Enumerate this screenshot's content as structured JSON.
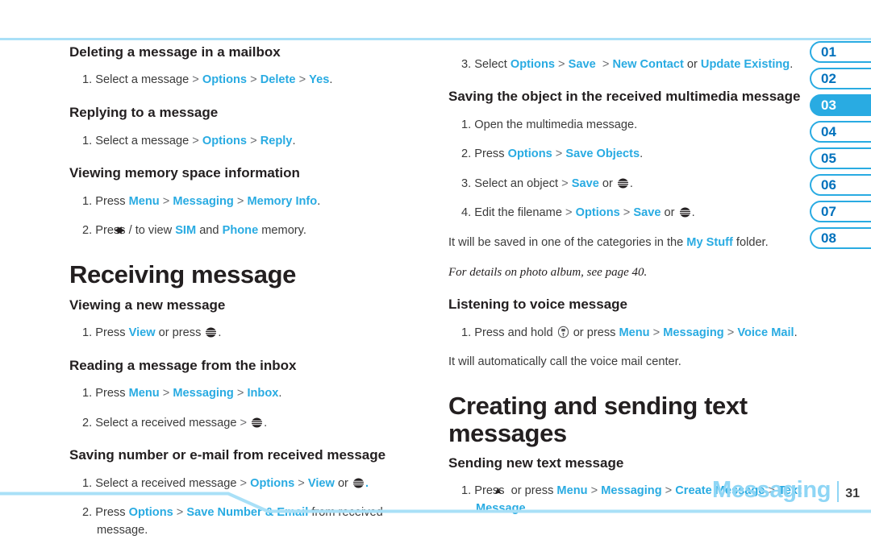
{
  "page": {
    "footer_chapter": "Messaging",
    "footer_page": "31",
    "accent_color": "#29abe2",
    "rule_color": "#a9e0f7",
    "text_color": "#231f20"
  },
  "side_tabs": {
    "items": [
      {
        "label": "01",
        "active": false
      },
      {
        "label": "02",
        "active": false
      },
      {
        "label": "03",
        "active": true
      },
      {
        "label": "04",
        "active": false
      },
      {
        "label": "05",
        "active": false
      },
      {
        "label": "06",
        "active": false
      },
      {
        "label": "07",
        "active": false
      },
      {
        "label": "08",
        "active": false
      }
    ]
  },
  "left_column": {
    "s1_head": "Deleting a message in a mailbox",
    "s1_step1_pre": "1. Select a message ",
    "s1_step1_sep1": ">",
    "s1_step1_k1": "Options",
    "s1_step1_sep2": ">",
    "s1_step1_k2": "Delete",
    "s1_step1_sep3": ">",
    "s1_step1_k3": "Yes",
    "s1_step1_end": ".",
    "s2_head": "Replying to a message",
    "s2_step1_pre": "1. Select a message ",
    "s2_step1_sep1": ">",
    "s2_step1_k1": "Options",
    "s2_step1_sep2": ">",
    "s2_step1_k2": "Reply",
    "s2_step1_end": ".",
    "s3_head": "Viewing memory space information",
    "s3_step1_pre": "1. Press ",
    "s3_step1_k1": "Menu",
    "s3_step1_sep1": ">",
    "s3_step1_k2": "Messaging",
    "s3_step1_sep2": ">",
    "s3_step1_k3": "Memory Info",
    "s3_step1_end": ".",
    "s3_step2_pre": "2. Press ",
    "s3_step2_mid": " to view ",
    "s3_step2_k1": "SIM",
    "s3_step2_and": " and ",
    "s3_step2_k2": "Phone",
    "s3_step2_end": " memory.",
    "chapter_title": "Receiving message",
    "s4_head": "Viewing a new message",
    "s4_step1_pre": "1. Press ",
    "s4_step1_k1": "View",
    "s4_step1_mid": " or press ",
    "s4_step1_end": ".",
    "s5_head": "Reading a message from the inbox",
    "s5_step1_pre": "1. Press ",
    "s5_step1_k1": "Menu",
    "s5_step1_sep1": ">",
    "s5_step1_k2": "Messaging",
    "s5_step1_sep2": ">",
    "s5_step1_k3": "Inbox",
    "s5_step1_end": ".",
    "s5_step2_pre": "2. Select a received message ",
    "s5_step2_sep1": ">",
    "s5_step2_end": ".",
    "s6_head": "Saving number or e-mail from received message",
    "s6_step1_pre": "1. Select a received message ",
    "s6_step1_sep1": ">",
    "s6_step1_k1": "Options",
    "s6_step1_sep2": ">",
    "s6_step1_k2": "View",
    "s6_step1_mid": " or ",
    "s6_step1_end": ".",
    "s6_step2_pre": "2. Press ",
    "s6_step2_k1": "Options",
    "s6_step2_sep1": ">",
    "s6_step2_k2": "Save Number & Email",
    "s6_step2_end": " from received message."
  },
  "right_column": {
    "r1_step3_pre": "3. Select ",
    "r1_step3_k1": "Options",
    "r1_step3_sep1": ">",
    "r1_step3_k2": "Save",
    "r1_step3_sep2": ">",
    "r1_step3_k3": "New Contact",
    "r1_step3_or": " or ",
    "r1_step3_k4": "Update Existing",
    "r1_step3_end": ".",
    "r2_head": "Saving the object in the received multimedia message",
    "r2_step1": "1. Open the multimedia message.",
    "r2_step2_pre": "2. Press ",
    "r2_step2_k1": "Options",
    "r2_step2_sep1": ">",
    "r2_step2_k2": "Save Objects",
    "r2_step2_end": ".",
    "r2_step3_pre": "3. Select an object ",
    "r2_step3_sep1": ">",
    "r2_step3_k1": "Save",
    "r2_step3_mid": " or ",
    "r2_step3_end": ".",
    "r2_step4_pre": "4. Edit the filename ",
    "r2_step4_sep1": ">",
    "r2_step4_k1": "Options",
    "r2_step4_sep2": ">",
    "r2_step4_k2": "Save",
    "r2_step4_mid": " or ",
    "r2_step4_end": ".",
    "r2_note_pre": "It will be saved in one of the categories in the ",
    "r2_note_k1": "My Stuff",
    "r2_note_end": " folder.",
    "r2_note_italic": "For details on photo album, see page 40.",
    "r3_head": "Listening to voice message",
    "r3_step1_pre": "1. Press and hold ",
    "r3_step1_mid": " or press ",
    "r3_step1_k1": "Menu",
    "r3_step1_sep1": ">",
    "r3_step1_k2": "Messaging",
    "r3_step1_sep2": ">",
    "r3_step1_k3": "Voice Mail",
    "r3_step1_end": ".",
    "r3_note": "It will automatically call the voice mail center.",
    "chapter_title": "Creating and sending text messages",
    "r4_head": "Sending new text message",
    "r4_step1_pre": "1. Press ",
    "r4_step1_mid": " or press ",
    "r4_step1_k1": "Menu",
    "r4_step1_sep1": ">",
    "r4_step1_k2": "Messaging",
    "r4_step1_sep2": ">",
    "r4_step1_k3": "Create Message",
    "r4_step1_sep3": ">",
    "r4_step1_k4": "Text Message",
    "r4_step1_end": "."
  },
  "icons": {
    "att_globe": "att-globe-icon",
    "voicemail_key": "voicemail-key-icon",
    "arrow_left": "◀",
    "arrow_right": "▶",
    "arrow_up": "▲",
    "slash": "/"
  }
}
